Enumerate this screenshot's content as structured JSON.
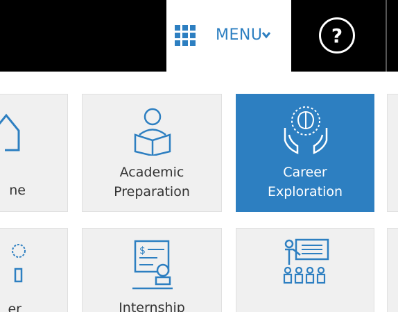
{
  "header": {
    "menu_label": "MENU",
    "menu_icon": "grid-icon",
    "chevron_icon": "chevron-down-icon",
    "help_label": "?",
    "accent_color": "#2d7fc1"
  },
  "tiles": [
    {
      "label_line1": "",
      "label_line2": "ne",
      "icon": "home-icon"
    },
    {
      "label_line1": "Academic",
      "label_line2": "Preparation",
      "icon": "reading-person-icon"
    },
    {
      "label_line1": "Career",
      "label_line2": "Exploration",
      "icon": "brain-in-hands-icon",
      "active": true
    },
    {
      "label_line1": "",
      "label_line2": "er",
      "icon": "badge-icon"
    },
    {
      "label_line1": "",
      "label_line2": "Internship",
      "icon": "certificate-stamp-icon"
    },
    {
      "label_line1": "",
      "label_line2": "",
      "icon": "presentation-audience-icon"
    }
  ]
}
